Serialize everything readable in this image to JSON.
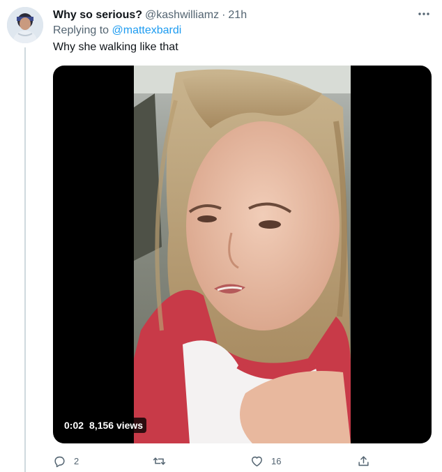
{
  "tweet": {
    "display_name": "Why so serious?",
    "handle": "@kashwilliamz",
    "separator": "·",
    "time": "21h",
    "more_label": "···",
    "replying_prefix": "Replying to",
    "replying_to": "@mattexbardi",
    "text": "Why she walking like that",
    "video": {
      "duration": "0:02",
      "views": "8,156 views"
    },
    "actions": {
      "reply_count": "2",
      "like_count": "16"
    }
  },
  "colors": {
    "accent": "#1d9bf0",
    "secondary_text": "#536471",
    "primary_text": "#0f1419"
  },
  "icons": [
    "more-icon",
    "reply-icon",
    "retweet-icon",
    "like-icon",
    "share-icon"
  ]
}
